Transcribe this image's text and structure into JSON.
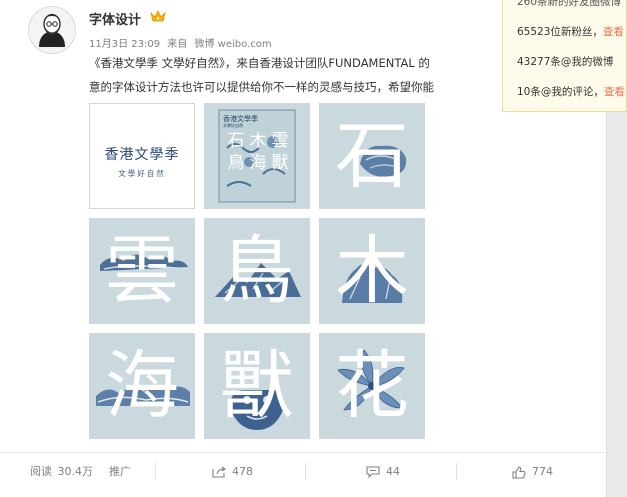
{
  "post": {
    "username": "字体设计",
    "vip_badge_icon": "vip-badge-icon",
    "timestamp": "11月3日 23:09",
    "source_prefix": "来自",
    "source": "微博 weibo.com",
    "text_line1": "《香港文學季 文學好自然》，来自香港设计团队FUNDAMENTAL 的",
    "text_line2": "意的字体设计方法也许可以提供给你不一样的灵感与技巧，希望你能"
  },
  "grid": {
    "cover_title": "香港文學季",
    "cover_subtitle": "文學好自然",
    "poster_title": "香港文學季",
    "poster_subtitle": "文學好自然",
    "poster_chars": [
      "石",
      "木",
      "雲",
      "鳥",
      "海",
      "獸"
    ],
    "chars": [
      "石",
      "雲",
      "鳥",
      "木",
      "海",
      "獸",
      "花"
    ]
  },
  "actions": {
    "reads_label": "阅读",
    "reads_count": "30.4万",
    "promote_label": "推广",
    "share_count": "478",
    "comment_count": "44",
    "like_count": "774"
  },
  "notifications": {
    "partial_top": "260条新的好友圈微博",
    "new_fans": "65523位新粉丝，",
    "new_fans_link": "查看",
    "mentions_weibo": "43277条@我的微博",
    "mentions_comment": "10条@我的评论，",
    "mentions_comment_link": "查看"
  },
  "colors": {
    "tile_blue": "#cad9de",
    "ink_blue": "#2c4a77",
    "link_orange": "#eb7350",
    "notify_bg": "#fffbea"
  }
}
